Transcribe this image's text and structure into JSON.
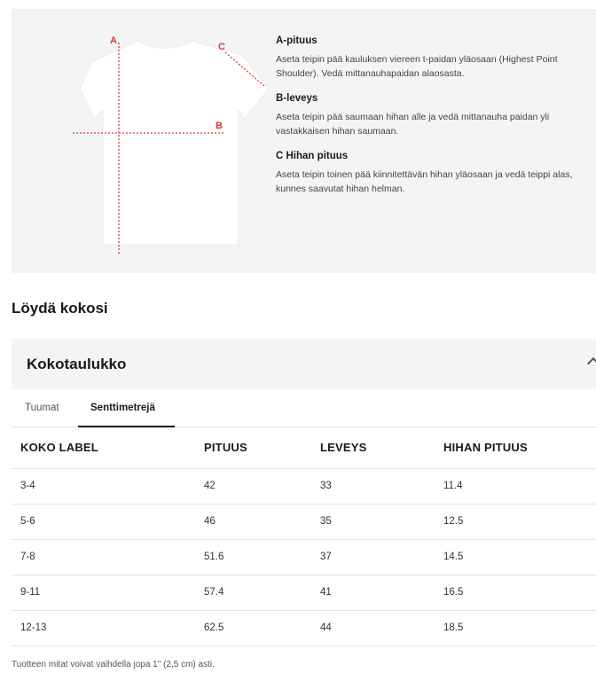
{
  "guide": {
    "markers": {
      "a": "A",
      "b": "B",
      "c": "C"
    },
    "items": [
      {
        "title": "A-pituus",
        "lines": [
          "Aseta teipin pää kauluksen viereen t-paidan yläosaan (Highest Point",
          "Shoulder). Vedä mittanauhapaidan alaosasta."
        ]
      },
      {
        "title": "B-leveys",
        "lines": [
          "Aseta teipin pää saumaan hihan alle ja vedä mittanauha paidan yli",
          "vastakkaisen hihan saumaan."
        ]
      },
      {
        "title": "C Hihan pituus",
        "lines": [
          "Aseta teipin toinen pää kiinnitettävän hihan yläosaan ja vedä teippi alas,",
          "kunnes saavutat hihan helman."
        ]
      }
    ],
    "colors": {
      "measure_line": "#d63a3a",
      "panel_bg": "#f4f4f4"
    }
  },
  "find_size_heading": "Löydä kokosi",
  "chart": {
    "title": "Kokotaulukko",
    "collapse_icon": "chevron-up-icon",
    "tabs": [
      {
        "label": "Tuumat",
        "active": false
      },
      {
        "label": "Senttimetrejä",
        "active": true
      }
    ],
    "columns": [
      "KOKO LABEL",
      "PITUUS",
      "LEVEYS",
      "HIHAN PITUUS"
    ],
    "rows": [
      [
        "3-4",
        "42",
        "33",
        "11.4"
      ],
      [
        "5-6",
        "46",
        "35",
        "12.5"
      ],
      [
        "7-8",
        "51.6",
        "37",
        "14.5"
      ],
      [
        "9-11",
        "57.4",
        "41",
        "16.5"
      ],
      [
        "12-13",
        "62.5",
        "44",
        "18.5"
      ]
    ]
  },
  "note": "Tuotteen mitat voivat vaihdella jopa 1\" (2,5 cm) asti."
}
